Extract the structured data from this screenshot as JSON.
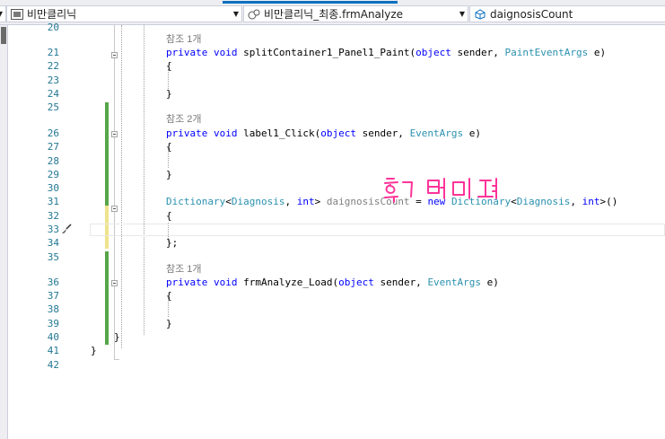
{
  "navbar": {
    "project": "비만클리닉",
    "type_member": "비만클리닉_최종.frmAnalyze",
    "member": "daignosisCount"
  },
  "lines": [
    {
      "num": "20",
      "text": ""
    },
    {
      "num": "21",
      "text": "private void splitContainer1_Panel1_Paint(object sender, PaintEventArgs e)"
    },
    {
      "num": "22",
      "text": "{"
    },
    {
      "num": "23",
      "text": ""
    },
    {
      "num": "24",
      "text": "}"
    },
    {
      "num": "25",
      "text": ""
    },
    {
      "num": "26",
      "text": "private void label1_Click(object sender, EventArgs e)"
    },
    {
      "num": "27",
      "text": "{"
    },
    {
      "num": "28",
      "text": ""
    },
    {
      "num": "29",
      "text": "}"
    },
    {
      "num": "30",
      "text": ""
    },
    {
      "num": "31",
      "text": "Dictionary<Diagnosis, int> daignosisCount = new Dictionary<Diagnosis, int>()"
    },
    {
      "num": "32",
      "text": "{"
    },
    {
      "num": "33",
      "text": ""
    },
    {
      "num": "34",
      "text": "};"
    },
    {
      "num": "35",
      "text": ""
    },
    {
      "num": "36",
      "text": "private void frmAnalyze_Load(object sender, EventArgs e)"
    },
    {
      "num": "37",
      "text": "{"
    },
    {
      "num": "38",
      "text": ""
    },
    {
      "num": "39",
      "text": "}"
    },
    {
      "num": "40",
      "text": "}"
    },
    {
      "num": "41",
      "text": "}"
    },
    {
      "num": "42",
      "text": ""
    }
  ],
  "refs": [
    "참조 1개",
    "참조 2개",
    "참조 1개"
  ],
  "colors": {
    "accent": "#0e70c0",
    "keyword": "#0000ff",
    "type": "#2b91af",
    "linenum": "#237893",
    "changed": "#57a64a",
    "unsaved": "#efe38c",
    "annotation": "#ff3399"
  }
}
